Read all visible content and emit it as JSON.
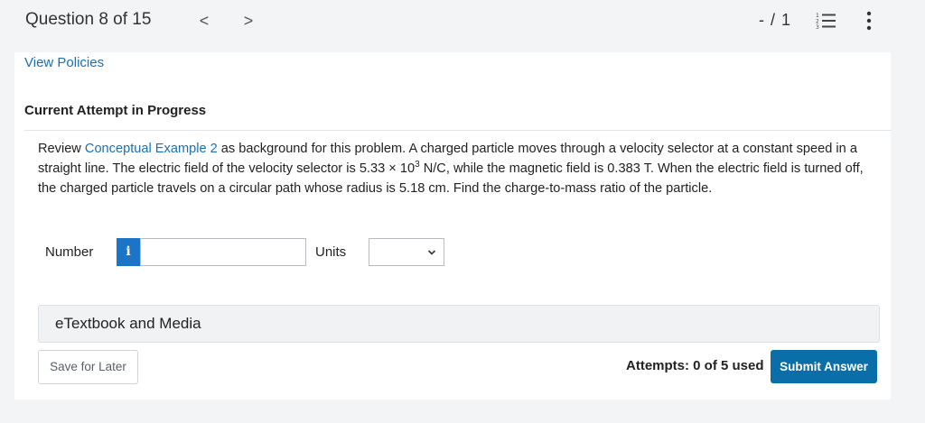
{
  "header": {
    "question_position": "Question 8 of 15",
    "prev_label": "<",
    "next_label": ">",
    "score": "- / 1"
  },
  "links": {
    "view_policies": "View Policies"
  },
  "attempt": {
    "heading": "Current Attempt in Progress"
  },
  "problem": {
    "part1": "Review ",
    "link_text": "Conceptual Example 2",
    "part2": " as background for this problem. A charged particle moves through a velocity selector at a constant speed in a straight line. The electric field of the velocity selector is 5.33 × 10",
    "exponent": "3",
    "part3": " N/C, while the magnetic field is 0.383 T. When the electric field is turned off, the charged particle travels on a circular path whose radius is 5.18 cm. Find the charge-to-mass ratio of the particle."
  },
  "answer": {
    "number_label": "Number",
    "info_label": "i",
    "number_value": "",
    "units_label": "Units",
    "units_selected": ""
  },
  "etextbook": {
    "label": "eTextbook and Media"
  },
  "footer": {
    "save_label": "Save for Later",
    "attempts_text": "Attempts: 0 of 5 used",
    "submit_label": "Submit Answer"
  },
  "colors": {
    "link": "#1a6fb5",
    "info_button": "#1c74c6",
    "submit_button": "#0a6ea8",
    "page_background": "#f3f4f6"
  },
  "icons": {
    "prev": "chevron-left-icon",
    "next": "chevron-right-icon",
    "list": "numbered-list-icon",
    "more": "more-vertical-icon",
    "units_dropdown": "chevron-down-icon"
  }
}
